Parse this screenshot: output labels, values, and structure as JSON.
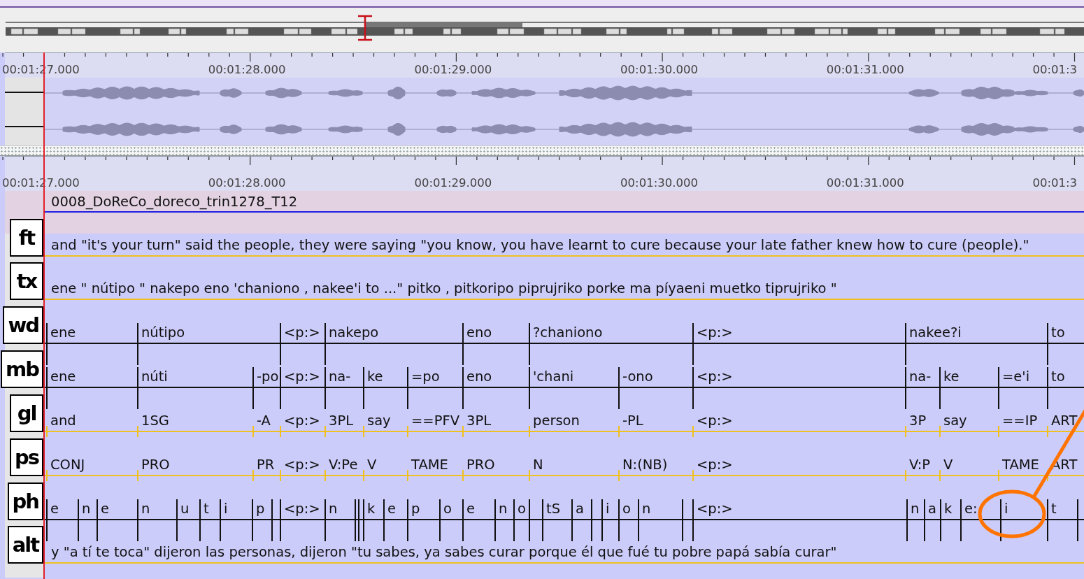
{
  "rulers": [
    {
      "labels": [
        "00:01:27.000",
        "00:01:28.000",
        "00:01:29.000",
        "00:01:30.000",
        "00:01:31.000",
        "00:01:3"
      ]
    },
    {
      "labels": [
        "00:01:27.000",
        "00:01:28.000",
        "00:01:29.000",
        "00:01:30.000",
        "00:01:31.000",
        "00:01:3"
      ]
    }
  ],
  "main_tier": {
    "text": "0008_DoReCo_doreco_trin1278_T12"
  },
  "tiers": [
    {
      "label": "ft",
      "kind": "text",
      "text": "and \"it's your turn\" said the people, they were saying \"you know, you have learnt to cure because your late father knew how to cure (people).\""
    },
    {
      "label": "tx",
      "kind": "text",
      "text": "ene \" nútipo \" nakepo eno 'chaniono , nakee'i to ...\" pitko , pitkoripo piprujriko porke ma píyaeni muetko tiprujriko \""
    },
    {
      "label": "wd",
      "kind": "aligned",
      "segments": [
        "ene",
        "nútipo",
        "<p:>",
        "nakepo",
        "eno",
        "?chaniono",
        "<p:>",
        "nakee?i",
        "to"
      ]
    },
    {
      "label": "mb",
      "kind": "aligned",
      "segments": [
        "ene",
        "núti",
        "-po",
        "<p:>",
        "na-",
        "ke",
        "=po",
        "eno",
        "'chani",
        "-ono",
        "<p:>",
        "na-",
        "ke",
        "=e'i",
        "to"
      ]
    },
    {
      "label": "gl",
      "kind": "associated",
      "segments": [
        "and",
        "1SG",
        "-A",
        "<p:>",
        "3PL",
        "say",
        "==PFV",
        "3PL",
        "person",
        "-PL",
        "<p:>",
        "3P",
        "say",
        "==IP",
        "ART"
      ]
    },
    {
      "label": "ps",
      "kind": "associated",
      "segments": [
        "CONJ",
        "PRO",
        "PR",
        "<p:>",
        "V:Pe",
        "V",
        "TAME",
        "PRO",
        "N",
        "N:(NB)",
        "<p:>",
        "V:P",
        "V",
        "TAME",
        "ART"
      ]
    },
    {
      "label": "ph",
      "kind": "aligned",
      "segments": [
        "e",
        "n",
        "e",
        "n",
        "u",
        "t",
        "i",
        "p",
        "<p:>",
        "n",
        "k",
        "e",
        "p",
        "o",
        "e",
        "n",
        "o",
        "tS",
        "a",
        "i",
        "o",
        "n",
        "<p:>",
        "n",
        "a",
        "k",
        "e:",
        "i",
        "t"
      ]
    },
    {
      "label": "alt",
      "kind": "text",
      "text": "y \"a tí te toca\" dijeron las personas, dijeron \"tu sabes, ya sabes curar porque él que fué tu pobre papá sabía curar\""
    }
  ]
}
